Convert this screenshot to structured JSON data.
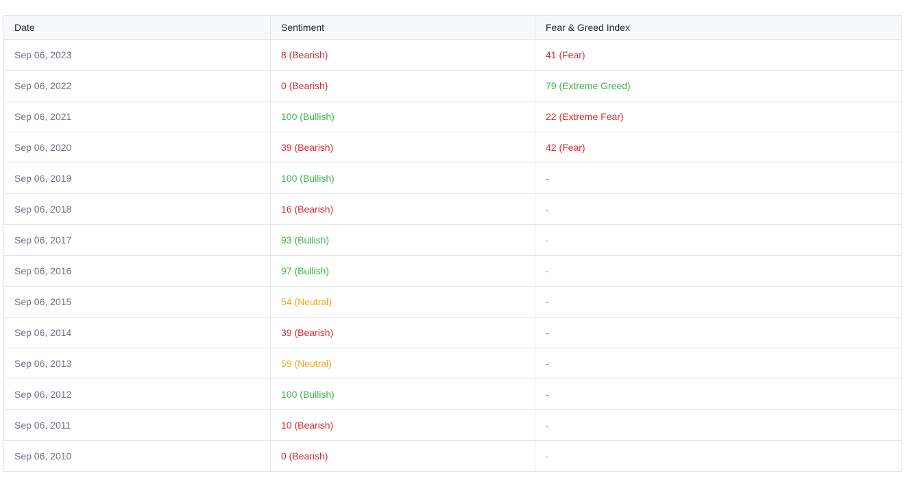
{
  "colors": {
    "bearish": "#e0282e",
    "bullish": "#3bb44a",
    "neutral": "#f0a81c",
    "fear": "#e0282e",
    "extreme_fear": "#e0282e",
    "extreme_greed": "#3bb44a",
    "none": "#8a8f98"
  },
  "table": {
    "headers": [
      "Date",
      "Sentiment",
      "Fear & Greed Index"
    ],
    "rows": [
      {
        "date": "Sep 06, 2023",
        "sentiment": "8 (Bearish)",
        "sentiment_kind": "bearish",
        "fgi": "41 (Fear)",
        "fgi_kind": "fear"
      },
      {
        "date": "Sep 06, 2022",
        "sentiment": "0 (Bearish)",
        "sentiment_kind": "bearish",
        "fgi": "79 (Extreme Greed)",
        "fgi_kind": "extreme_greed"
      },
      {
        "date": "Sep 06, 2021",
        "sentiment": "100 (Bullish)",
        "sentiment_kind": "bullish",
        "fgi": "22 (Extreme Fear)",
        "fgi_kind": "extreme_fear"
      },
      {
        "date": "Sep 06, 2020",
        "sentiment": "39 (Bearish)",
        "sentiment_kind": "bearish",
        "fgi": "42 (Fear)",
        "fgi_kind": "fear"
      },
      {
        "date": "Sep 06, 2019",
        "sentiment": "100 (Bullish)",
        "sentiment_kind": "bullish",
        "fgi": "-",
        "fgi_kind": "none"
      },
      {
        "date": "Sep 06, 2018",
        "sentiment": "16 (Bearish)",
        "sentiment_kind": "bearish",
        "fgi": "-",
        "fgi_kind": "none"
      },
      {
        "date": "Sep 06, 2017",
        "sentiment": "93 (Bullish)",
        "sentiment_kind": "bullish",
        "fgi": "-",
        "fgi_kind": "none"
      },
      {
        "date": "Sep 06, 2016",
        "sentiment": "97 (Bullish)",
        "sentiment_kind": "bullish",
        "fgi": "-",
        "fgi_kind": "none"
      },
      {
        "date": "Sep 06, 2015",
        "sentiment": "54 (Neutral)",
        "sentiment_kind": "neutral",
        "fgi": "-",
        "fgi_kind": "none"
      },
      {
        "date": "Sep 06, 2014",
        "sentiment": "39 (Bearish)",
        "sentiment_kind": "bearish",
        "fgi": "-",
        "fgi_kind": "none"
      },
      {
        "date": "Sep 06, 2013",
        "sentiment": "59 (Neutral)",
        "sentiment_kind": "neutral",
        "fgi": "-",
        "fgi_kind": "none"
      },
      {
        "date": "Sep 06, 2012",
        "sentiment": "100 (Bullish)",
        "sentiment_kind": "bullish",
        "fgi": "-",
        "fgi_kind": "none"
      },
      {
        "date": "Sep 06, 2011",
        "sentiment": "10 (Bearish)",
        "sentiment_kind": "bearish",
        "fgi": "-",
        "fgi_kind": "none"
      },
      {
        "date": "Sep 06, 2010",
        "sentiment": "0 (Bearish)",
        "sentiment_kind": "bearish",
        "fgi": "-",
        "fgi_kind": "none"
      }
    ]
  }
}
